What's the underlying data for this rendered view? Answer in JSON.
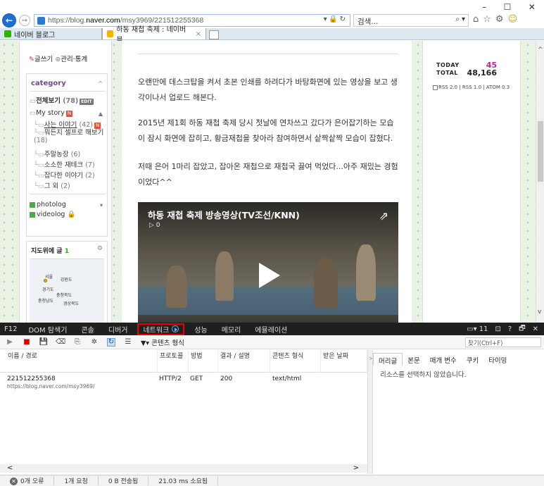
{
  "window": {
    "minimize": "–",
    "maximize": "☐",
    "close": "✕"
  },
  "nav": {
    "url_prefix": "https://blog.",
    "url_host": "naver.com",
    "url_rest": "/msy3969/221512255368",
    "addr_controls": "▾ 🔒 ↻",
    "search_placeholder": "검색...",
    "search_controls": "⌕ ▾"
  },
  "tabs": [
    {
      "label": "네이버 블로그"
    },
    {
      "label": "하동 재첩 축제 : 네이버 블...",
      "close": "×"
    }
  ],
  "blog": {
    "write": "글쓰기",
    "manage": "관리·통계",
    "category_title": "category",
    "all_label": "전체보기",
    "all_count": "(78)",
    "all_badge": "EDIT",
    "categories": [
      {
        "label": "My story",
        "badge": "N"
      },
      {
        "label": "사는 이야기",
        "count": "(42)",
        "badge": "N"
      },
      {
        "label": "뭐든지 셀프로 해보기",
        "count": "(18)"
      },
      {
        "label": "주말농장",
        "count": "(6)"
      },
      {
        "label": "소소한 재테크",
        "count": "(7)"
      },
      {
        "label": "잡다한 이야기",
        "count": "(2)"
      },
      {
        "label": "그 외",
        "count": "(2)"
      }
    ],
    "photolog": "photolog",
    "videolog": "videolog",
    "map_title": "지도위에 글",
    "map_count": "1",
    "map_cities": [
      "서울",
      "강원도",
      "경기도",
      "충청북도",
      "충청남도",
      "경상북도"
    ]
  },
  "article": {
    "p1": "오랜만에 데스크탑을 켜서 초본 인쇄를 하려다가 바탕화면에 있는 영상을 보고 생각이나서 업로드 해본다.",
    "p2": "2015년 제1회 하동 재첩 축제 당시 첫날에 연차쓰고 갔다가 은어잡기하는 모습이 잠시 화면에 잡히고, 황금재첩을 찾아라 참여하면서 샅짝샅짝 모습이 잡혔다.",
    "p3": "저때 은어 1마리 잡았고, 잡아온 재첩으로 재첩국 끓여 먹었다...아주 재밌는 경험이었다^^",
    "video_title": "하동 재첩 축제 방송영상(TV조선/KNN)",
    "video_count": "▷ 0"
  },
  "stats": {
    "today_label": "TODAY",
    "today_value": "45",
    "total_label": "TOTAL",
    "total_value": "48,166",
    "rss": "RSS 2.0 | RSS 1.0 | ATOM 0.3"
  },
  "devtools": {
    "f12": "F12",
    "tabs": [
      "DOM 탐색기",
      "콘솔",
      "디버거",
      "네트워크",
      "성능",
      "메모리",
      "에뮬레이션"
    ],
    "right": [
      "▭▾ 11",
      "⊡",
      "?",
      "🗗",
      "✕"
    ],
    "content_type_filter": "콘텐츠 형식",
    "find_placeholder": "찾기(Ctrl+F)",
    "columns": [
      "이름 / 경로",
      "프로토콜",
      "방법",
      "결과 / 설명",
      "콘텐츠 형식",
      "받은 날짜"
    ],
    "row": {
      "name": "221512255368",
      "path": "https://blog.naver.com/msy3969/",
      "protocol": "HTTP/2",
      "method": "GET",
      "result": "200",
      "content_type": "text/html"
    },
    "detail_tabs": [
      "머리글",
      "본문",
      "매개 변수",
      "쿠키",
      "타이밍"
    ],
    "detail_msg": "리소스를 선택하지 않았습니다.",
    "status": [
      "0개 오류",
      "1개 요청",
      "0 B 전송됨",
      "21.03 ms 소요됨"
    ]
  }
}
